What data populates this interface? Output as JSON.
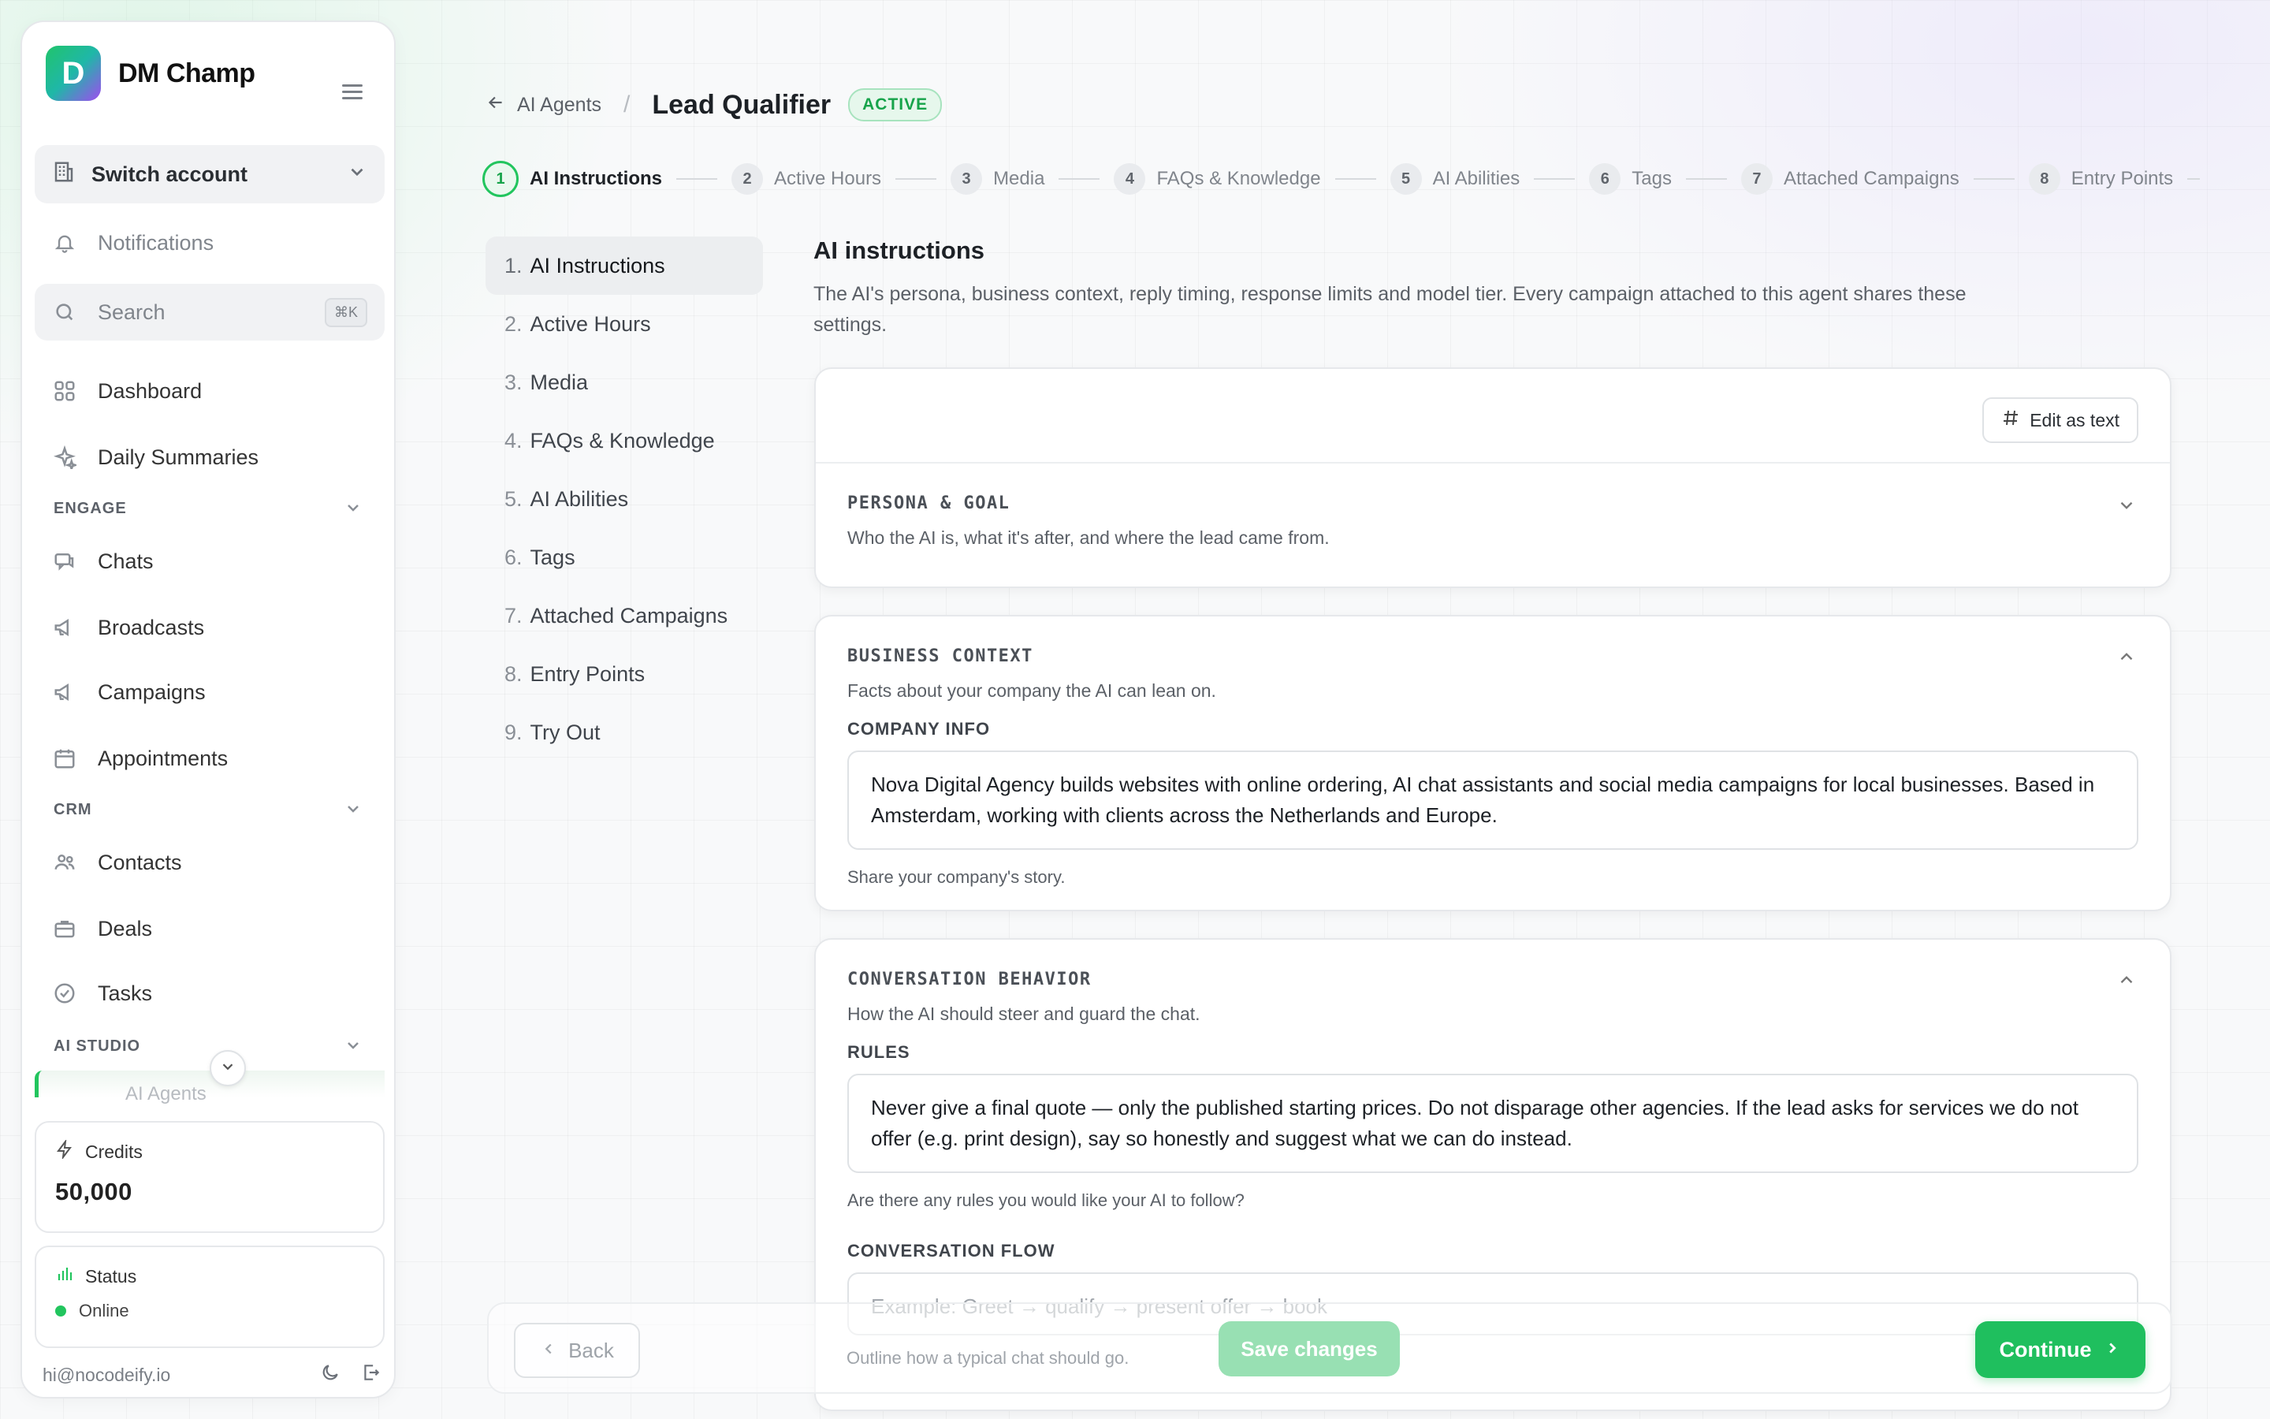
{
  "brand": {
    "name": "DM Champ",
    "logo_letter": "D"
  },
  "sidebar": {
    "switch_account": "Switch account",
    "notifications": "Notifications",
    "search": {
      "label": "Search",
      "shortcut": "⌘K"
    },
    "items_top": [
      {
        "label": "Dashboard",
        "icon": "grid-icon"
      },
      {
        "label": "Daily Summaries",
        "icon": "sparkles-icon"
      }
    ],
    "engage": {
      "label": "ENGAGE",
      "items": [
        {
          "label": "Chats",
          "icon": "chat-icon"
        },
        {
          "label": "Broadcasts",
          "icon": "megaphone-icon"
        },
        {
          "label": "Campaigns",
          "icon": "megaphone-icon"
        },
        {
          "label": "Appointments",
          "icon": "calendar-icon"
        }
      ]
    },
    "crm": {
      "label": "CRM",
      "items": [
        {
          "label": "Contacts",
          "icon": "users-icon"
        },
        {
          "label": "Deals",
          "icon": "briefcase-icon"
        },
        {
          "label": "Tasks",
          "icon": "check-circle-icon"
        }
      ]
    },
    "ai_studio": {
      "label": "AI STUDIO",
      "partial_item": "AI Agents"
    },
    "credits": {
      "label": "Credits",
      "value": "50,000"
    },
    "status": {
      "label": "Status",
      "value": "Online",
      "color": "#22c55e"
    },
    "email": "hi@nocodeify.io"
  },
  "header": {
    "back_label": "AI Agents",
    "separator": "/",
    "title": "Lead Qualifier",
    "badge": "ACTIVE"
  },
  "stepper": [
    {
      "num": "1",
      "label": "AI Instructions",
      "active": true
    },
    {
      "num": "2",
      "label": "Active Hours"
    },
    {
      "num": "3",
      "label": "Media"
    },
    {
      "num": "4",
      "label": "FAQs & Knowledge"
    },
    {
      "num": "5",
      "label": "AI Abilities"
    },
    {
      "num": "6",
      "label": "Tags"
    },
    {
      "num": "7",
      "label": "Attached Campaigns"
    },
    {
      "num": "8",
      "label": "Entry Points"
    }
  ],
  "stepnav": [
    {
      "num": "1.",
      "label": "AI Instructions",
      "active": true
    },
    {
      "num": "2.",
      "label": "Active Hours"
    },
    {
      "num": "3.",
      "label": "Media"
    },
    {
      "num": "4.",
      "label": "FAQs & Knowledge"
    },
    {
      "num": "5.",
      "label": "AI Abilities"
    },
    {
      "num": "6.",
      "label": "Tags"
    },
    {
      "num": "7.",
      "label": "Attached Campaigns"
    },
    {
      "num": "8.",
      "label": "Entry Points"
    },
    {
      "num": "9.",
      "label": "Try Out"
    }
  ],
  "main": {
    "heading": "AI instructions",
    "description": "The AI's persona, business context, reply timing, response limits and model tier. Every campaign attached to this agent shares these settings.",
    "edit_as_text": "Edit as text",
    "persona": {
      "title": "PERSONA & GOAL",
      "subtitle": "Who the AI is, what it's after, and where the lead came from."
    },
    "business": {
      "title": "BUSINESS CONTEXT",
      "subtitle": "Facts about your company the AI can lean on.",
      "field_label": "COMPANY INFO",
      "value": "Nova Digital Agency builds websites with online ordering, AI chat assistants and social media campaigns for local businesses. Based in Amsterdam, working with clients across the Netherlands and Europe.",
      "help": "Share your company's story."
    },
    "behavior": {
      "title": "CONVERSATION BEHAVIOR",
      "subtitle": "How the AI should steer and guard the chat.",
      "rules_label": "RULES",
      "rules_value": "Never give a final quote — only the published starting prices. Do not disparage other agencies. If the lead asks for services we do not offer (e.g. print design), say so honestly and suggest what we can do instead.",
      "rules_help": "Are there any rules you would like your AI to follow?",
      "flow_label": "CONVERSATION FLOW",
      "flow_placeholder": "Example: Greet → qualify → present offer → book",
      "flow_help": "Outline how a typical chat should go."
    }
  },
  "footer": {
    "back": "Back",
    "save": "Save changes",
    "continue": "Continue"
  }
}
